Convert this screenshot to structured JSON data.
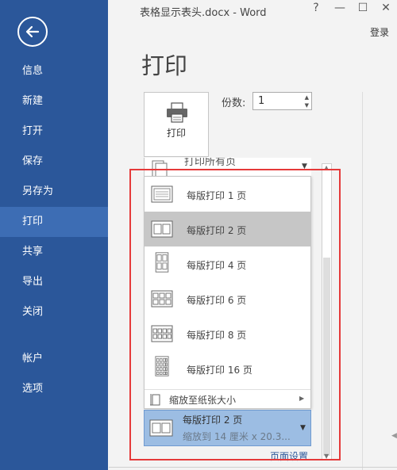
{
  "window": {
    "title": "表格显示表头.docx - Word",
    "help": "?",
    "minimize": "—",
    "maximize": "☐",
    "close": "✕",
    "signin": "登录"
  },
  "sidebar": {
    "back_icon": "back-arrow-icon",
    "items": [
      {
        "label": "信息"
      },
      {
        "label": "新建"
      },
      {
        "label": "打开"
      },
      {
        "label": "保存"
      },
      {
        "label": "另存为"
      },
      {
        "label": "打印",
        "active": true
      },
      {
        "label": "共享"
      },
      {
        "label": "导出"
      },
      {
        "label": "关闭"
      },
      {
        "label": "帐户"
      },
      {
        "label": "选项"
      }
    ],
    "colors": {
      "bg": "#2b579a",
      "active": "#3d6db4"
    }
  },
  "main": {
    "heading": "打印",
    "print_button_label": "打印",
    "copies_label": "份数:",
    "copies_value": "1",
    "partial_setting_text": "打印所有页",
    "pages_per_sheet_options": [
      {
        "label": "每版打印 1 页",
        "icon": "layout-1-icon"
      },
      {
        "label": "每版打印 2 页",
        "icon": "layout-2-icon",
        "selected": true
      },
      {
        "label": "每版打印 4 页",
        "icon": "layout-4-icon"
      },
      {
        "label": "每版打印 6 页",
        "icon": "layout-6-icon"
      },
      {
        "label": "每版打印 8 页",
        "icon": "layout-8-icon"
      },
      {
        "label": "每版打印 16 页",
        "icon": "layout-16-icon"
      }
    ],
    "scale_to_paper": "缩放至纸张大小",
    "selected_setting": {
      "line1": "每版打印 2 页",
      "line2": "缩放到 14 厘米 x 20.3..."
    },
    "page_setup_link": "页面设置"
  },
  "colors": {
    "highlight_border": "#e53a3a",
    "selected_bg": "#9cbde3",
    "option_hover": "#c6c6c6"
  }
}
